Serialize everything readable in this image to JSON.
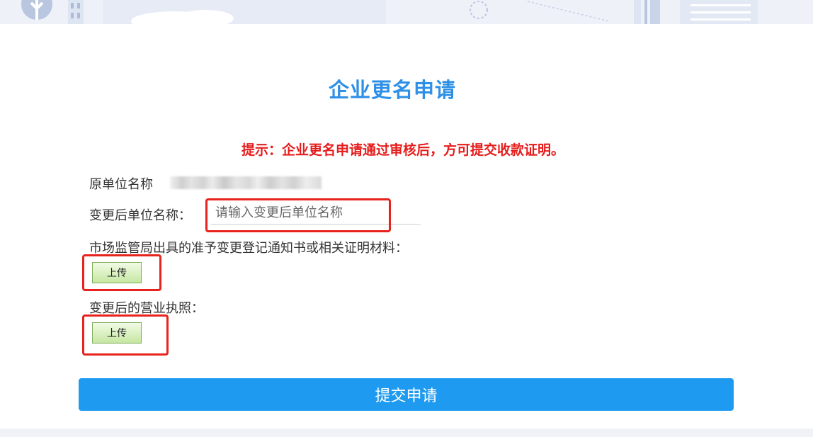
{
  "page": {
    "title": "企业更名申请",
    "notice": "提示：企业更名申请通过审核后，方可提交收款证明。"
  },
  "form": {
    "original_name_label": "原单位名称",
    "original_name_value": "",
    "new_name_label": "变更后单位名称：",
    "new_name_placeholder": "请输入变更后单位名称",
    "new_name_value": "",
    "notice_doc_label": "市场监管局出具的准予变更登记通知书或相关证明材料：",
    "notice_doc_upload_label": "上传",
    "license_label": "变更后的营业执照：",
    "license_upload_label": "上传",
    "submit_label": "提交申请"
  },
  "colors": {
    "title": "#2d8fe6",
    "notice": "#e61c1c",
    "submit_button": "#1e9af0",
    "highlight_box": "#e8231d",
    "upload_button_border": "#7fae5c"
  }
}
